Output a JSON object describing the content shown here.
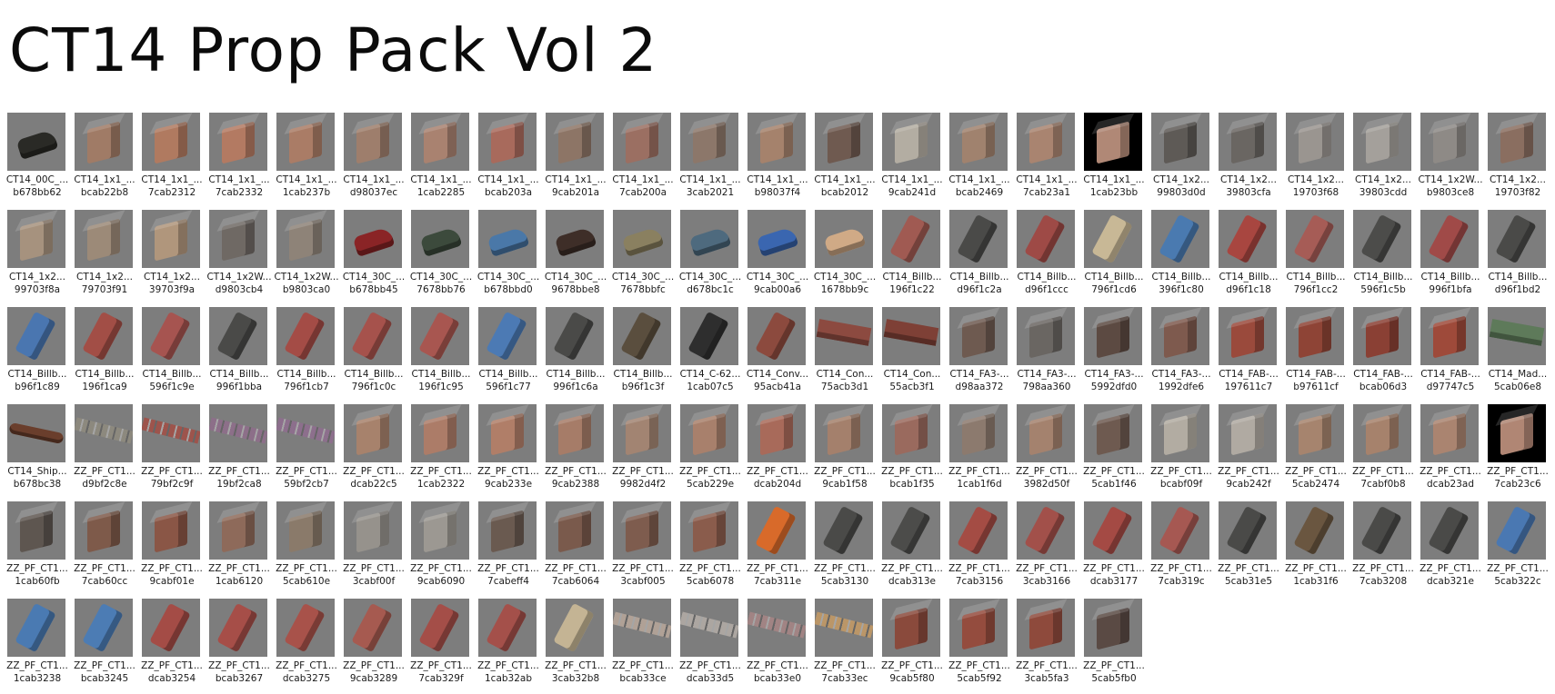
{
  "page_title": "CT14 Prop Pack Vol 2",
  "colors": {
    "thumb_bg": "#7d7d7d",
    "text": "#1a1a1a"
  },
  "items": [
    {
      "name": "CT14_00C_...",
      "id": "b678bb62",
      "kind": "car",
      "color": "#2a2a26"
    },
    {
      "name": "CT14_1x1_...",
      "id": "bcab22b8",
      "kind": "bldg",
      "color": "#a07b66"
    },
    {
      "name": "CT14_1x1_...",
      "id": "7cab2312",
      "kind": "bldg",
      "color": "#b07a60"
    },
    {
      "name": "CT14_1x1_...",
      "id": "7cab2332",
      "kind": "bldg",
      "color": "#b37a62"
    },
    {
      "name": "CT14_1x1_...",
      "id": "1cab237b",
      "kind": "bldg",
      "color": "#aa7c66"
    },
    {
      "name": "CT14_1x1_...",
      "id": "d98037ec",
      "kind": "bldg",
      "color": "#9e7e6c"
    },
    {
      "name": "CT14_1x1_...",
      "id": "1cab2285",
      "kind": "bldg",
      "color": "#a98270"
    },
    {
      "name": "CT14_1x1_...",
      "id": "bcab203a",
      "kind": "bldg",
      "color": "#a86a5c"
    },
    {
      "name": "CT14_1x1_...",
      "id": "9cab201a",
      "kind": "bldg",
      "color": "#8d7566"
    },
    {
      "name": "CT14_1x1_...",
      "id": "7cab200a",
      "kind": "bldg",
      "color": "#9b6f62"
    },
    {
      "name": "CT14_1x1_...",
      "id": "3cab2021",
      "kind": "bldg",
      "color": "#8c776a"
    },
    {
      "name": "CT14_1x1_...",
      "id": "b98037f4",
      "kind": "bldg",
      "color": "#a5826c"
    },
    {
      "name": "CT14_1x1_...",
      "id": "bcab2012",
      "kind": "bldg",
      "color": "#6f5a50"
    },
    {
      "name": "CT14_1x1_...",
      "id": "9cab241d",
      "kind": "bldg",
      "color": "#b3ada2"
    },
    {
      "name": "CT14_1x1_...",
      "id": "bcab2469",
      "kind": "bldg",
      "color": "#a0826e"
    },
    {
      "name": "CT14_1x1_...",
      "id": "7cab23a1",
      "kind": "bldg",
      "color": "#a98470"
    },
    {
      "name": "CT14_1x1_...",
      "id": "1cab23bb",
      "kind": "bldg",
      "color": "#b08876",
      "bg": "black"
    },
    {
      "name": "CT14_1x2...",
      "id": "99803d0d",
      "kind": "bldg",
      "color": "#5e5a56"
    },
    {
      "name": "CT14_1x2...",
      "id": "39803cfa",
      "kind": "bldg",
      "color": "#6a6662"
    },
    {
      "name": "CT14_1x2...",
      "id": "19703f68",
      "kind": "bldg",
      "color": "#9a9590"
    },
    {
      "name": "CT14_1x2...",
      "id": "39803cdd",
      "kind": "bldg",
      "color": "#a4a09b"
    },
    {
      "name": "CT14_1x2W...",
      "id": "b9803ce8",
      "kind": "bldg",
      "color": "#8e8a86"
    },
    {
      "name": "CT14_1x2...",
      "id": "19703f82",
      "kind": "bldg",
      "color": "#8a6e60"
    },
    {
      "name": "CT14_1x2...",
      "id": "99703f8a",
      "kind": "bldg",
      "color": "#a6927e"
    },
    {
      "name": "CT14_1x2...",
      "id": "79703f91",
      "kind": "bldg",
      "color": "#9c8a78"
    },
    {
      "name": "CT14_1x2...",
      "id": "39703f9a",
      "kind": "bldg",
      "color": "#b0967c"
    },
    {
      "name": "CT14_1x2W...",
      "id": "d9803cb4",
      "kind": "bldg",
      "color": "#6f6964"
    },
    {
      "name": "CT14_1x2W...",
      "id": "b9803ca0",
      "kind": "bldg",
      "color": "#8e8378"
    },
    {
      "name": "CT14_30C_...",
      "id": "b678bb45",
      "kind": "car",
      "color": "#8a2426"
    },
    {
      "name": "CT14_30C_...",
      "id": "7678bb76",
      "kind": "car",
      "color": "#3c4a3c"
    },
    {
      "name": "CT14_30C_...",
      "id": "b678bbd0",
      "kind": "car",
      "color": "#4a78a8"
    },
    {
      "name": "CT14_30C_...",
      "id": "9678bbe8",
      "kind": "car",
      "color": "#3e2e28"
    },
    {
      "name": "CT14_30C_...",
      "id": "7678bbfc",
      "kind": "car",
      "color": "#8a8060"
    },
    {
      "name": "CT14_30C_...",
      "id": "d678bc1c",
      "kind": "car",
      "color": "#4e6a7e"
    },
    {
      "name": "CT14_30C_...",
      "id": "9cab00a6",
      "kind": "car",
      "color": "#3a66b0"
    },
    {
      "name": "CT14_30C_...",
      "id": "1678bb9c",
      "kind": "car",
      "color": "#d0aa86"
    },
    {
      "name": "CT14_Billb...",
      "id": "196f1c22",
      "kind": "bill",
      "color": "#a05a52"
    },
    {
      "name": "CT14_Billb...",
      "id": "d96f1c2a",
      "kind": "bill",
      "color": "#4a4a48"
    },
    {
      "name": "CT14_Billb...",
      "id": "d96f1ccc",
      "kind": "bill",
      "color": "#9e4a46"
    },
    {
      "name": "CT14_Billb...",
      "id": "796f1cd6",
      "kind": "bill",
      "color": "#c8b896"
    },
    {
      "name": "CT14_Billb...",
      "id": "396f1c80",
      "kind": "bill",
      "color": "#4a7ab0"
    },
    {
      "name": "CT14_Billb...",
      "id": "d96f1c18",
      "kind": "bill",
      "color": "#a84640"
    },
    {
      "name": "CT14_Billb...",
      "id": "796f1cc2",
      "kind": "bill",
      "color": "#a65c56"
    },
    {
      "name": "CT14_Billb...",
      "id": "596f1c5b",
      "kind": "bill",
      "color": "#4c4c4a"
    },
    {
      "name": "CT14_Billb...",
      "id": "996f1bfa",
      "kind": "bill",
      "color": "#a04a48"
    },
    {
      "name": "CT14_Billb...",
      "id": "d96f1bd2",
      "kind": "bill",
      "color": "#4a4a48"
    },
    {
      "name": "CT14_Billb...",
      "id": "b96f1c89",
      "kind": "bill",
      "color": "#4a76b0"
    },
    {
      "name": "CT14_Billb...",
      "id": "196f1ca9",
      "kind": "bill",
      "color": "#a24e46"
    },
    {
      "name": "CT14_Billb...",
      "id": "596f1c9e",
      "kind": "bill",
      "color": "#a65450"
    },
    {
      "name": "CT14_Billb...",
      "id": "996f1bba",
      "kind": "bill",
      "color": "#4a4a48"
    },
    {
      "name": "CT14_Billb...",
      "id": "796f1cb7",
      "kind": "bill",
      "color": "#a44c46"
    },
    {
      "name": "CT14_Billb...",
      "id": "796f1c0c",
      "kind": "bill",
      "color": "#a6524c"
    },
    {
      "name": "CT14_Billb...",
      "id": "196f1c95",
      "kind": "bill",
      "color": "#a85650"
    },
    {
      "name": "CT14_Billb...",
      "id": "596f1c77",
      "kind": "bill",
      "color": "#4c7ab4"
    },
    {
      "name": "CT14_Billb...",
      "id": "996f1c6a",
      "kind": "bill",
      "color": "#4a4a48"
    },
    {
      "name": "CT14_Billb...",
      "id": "b96f1c3f",
      "kind": "bill",
      "color": "#5a4e3e"
    },
    {
      "name": "CT14_C-62...",
      "id": "1cab07c5",
      "kind": "bill",
      "color": "#2e2e2e"
    },
    {
      "name": "CT14_Conv...",
      "id": "95acb41a",
      "kind": "bill",
      "color": "#8c4a3e"
    },
    {
      "name": "CT14_Con...",
      "id": "75acb3d1",
      "kind": "flat",
      "color": "#8c4a40"
    },
    {
      "name": "CT14_Con...",
      "id": "55acb3f1",
      "kind": "flat",
      "color": "#7e4036"
    },
    {
      "name": "CT14_FA3-...",
      "id": "d98aa372",
      "kind": "bldg",
      "color": "#6e5a50"
    },
    {
      "name": "CT14_FA3-...",
      "id": "798aa360",
      "kind": "bldg",
      "color": "#6a6662"
    },
    {
      "name": "CT14_FA3-...",
      "id": "5992dfd0",
      "kind": "bldg",
      "color": "#5c4a42"
    },
    {
      "name": "CT14_FA3-...",
      "id": "1992dfe6",
      "kind": "bldg",
      "color": "#7e5a4e"
    },
    {
      "name": "CT14_FAB-...",
      "id": "197611c7",
      "kind": "bldg",
      "color": "#9a4a3c"
    },
    {
      "name": "CT14_FAB-...",
      "id": "b97611cf",
      "kind": "bldg",
      "color": "#8e4436"
    },
    {
      "name": "CT14_FAB-...",
      "id": "bcab06d3",
      "kind": "bldg",
      "color": "#8a4034"
    },
    {
      "name": "CT14_FAB-...",
      "id": "d97747c5",
      "kind": "bldg",
      "color": "#9e4a3a"
    },
    {
      "name": "CT14_Mad...",
      "id": "5cab06e8",
      "kind": "flat",
      "color": "#5e7a5a"
    },
    {
      "name": "CT14_Ship...",
      "id": "b678bc38",
      "kind": "ship",
      "color": "#6a3e2c"
    },
    {
      "name": "ZZ_PF_CT1...",
      "id": "d9bf2c8e",
      "kind": "strip",
      "color": "#8e8a7e"
    },
    {
      "name": "ZZ_PF_CT1...",
      "id": "79bf2c9f",
      "kind": "strip",
      "color": "#a05048"
    },
    {
      "name": "ZZ_PF_CT1...",
      "id": "19bf2ca8",
      "kind": "strip",
      "color": "#8e6e8a"
    },
    {
      "name": "ZZ_PF_CT1...",
      "id": "59bf2cb7",
      "kind": "strip",
      "color": "#8e6e8e"
    },
    {
      "name": "ZZ_PF_CT1...",
      "id": "dcab22c5",
      "kind": "bldg",
      "color": "#a7826c"
    },
    {
      "name": "ZZ_PF_CT1...",
      "id": "1cab2322",
      "kind": "bldg",
      "color": "#ac7c68"
    },
    {
      "name": "ZZ_PF_CT1...",
      "id": "9cab233e",
      "kind": "bldg",
      "color": "#b07e68"
    },
    {
      "name": "ZZ_PF_CT1...",
      "id": "9cab2388",
      "kind": "bldg",
      "color": "#a67c68"
    },
    {
      "name": "ZZ_PF_CT1...",
      "id": "9982d4f2",
      "kind": "bldg",
      "color": "#a28472"
    },
    {
      "name": "ZZ_PF_CT1...",
      "id": "5cab229e",
      "kind": "bldg",
      "color": "#a8806c"
    },
    {
      "name": "ZZ_PF_CT1...",
      "id": "dcab204d",
      "kind": "bldg",
      "color": "#a86a5a"
    },
    {
      "name": "ZZ_PF_CT1...",
      "id": "9cab1f58",
      "kind": "bldg",
      "color": "#a4806c"
    },
    {
      "name": "ZZ_PF_CT1...",
      "id": "bcab1f35",
      "kind": "bldg",
      "color": "#9a6a5e"
    },
    {
      "name": "ZZ_PF_CT1...",
      "id": "1cab1f6d",
      "kind": "bldg",
      "color": "#8c7a6e"
    },
    {
      "name": "ZZ_PF_CT1...",
      "id": "3982d50f",
      "kind": "bldg",
      "color": "#a4826e"
    },
    {
      "name": "ZZ_PF_CT1...",
      "id": "5cab1f46",
      "kind": "bldg",
      "color": "#6e5a50"
    },
    {
      "name": "ZZ_PF_CT1...",
      "id": "bcabf09f",
      "kind": "bldg",
      "color": "#b2aca2"
    },
    {
      "name": "ZZ_PF_CT1...",
      "id": "9cab242f",
      "kind": "bldg",
      "color": "#b0aaa2"
    },
    {
      "name": "ZZ_PF_CT1...",
      "id": "5cab2474",
      "kind": "bldg",
      "color": "#a6846e"
    },
    {
      "name": "ZZ_PF_CT1...",
      "id": "7cabf0b8",
      "kind": "bldg",
      "color": "#a6826c"
    },
    {
      "name": "ZZ_PF_CT1...",
      "id": "dcab23ad",
      "kind": "bldg",
      "color": "#aa8470"
    },
    {
      "name": "ZZ_PF_CT1...",
      "id": "7cab23c6",
      "kind": "bldg",
      "color": "#b08674",
      "bg": "black"
    },
    {
      "name": "ZZ_PF_CT1...",
      "id": "1cab60fb",
      "kind": "bldg",
      "color": "#5e5650"
    },
    {
      "name": "ZZ_PF_CT1...",
      "id": "7cab60cc",
      "kind": "bldg",
      "color": "#7e5a4a"
    },
    {
      "name": "ZZ_PF_CT1...",
      "id": "9cabf01e",
      "kind": "bldg",
      "color": "#8a5646"
    },
    {
      "name": "ZZ_PF_CT1...",
      "id": "1cab6120",
      "kind": "bldg",
      "color": "#8e6a5a"
    },
    {
      "name": "ZZ_PF_CT1...",
      "id": "5cab610e",
      "kind": "bldg",
      "color": "#8a7a6a"
    },
    {
      "name": "ZZ_PF_CT1...",
      "id": "3cabf00f",
      "kind": "bldg",
      "color": "#96928c"
    },
    {
      "name": "ZZ_PF_CT1...",
      "id": "9cab6090",
      "kind": "bldg",
      "color": "#9c9892"
    },
    {
      "name": "ZZ_PF_CT1...",
      "id": "7cabeff4",
      "kind": "bldg",
      "color": "#6a5a50"
    },
    {
      "name": "ZZ_PF_CT1...",
      "id": "7cab6064",
      "kind": "bldg",
      "color": "#7a5a4c"
    },
    {
      "name": "ZZ_PF_CT1...",
      "id": "3cabf005",
      "kind": "bldg",
      "color": "#7e5c4e"
    },
    {
      "name": "ZZ_PF_CT1...",
      "id": "5cab6078",
      "kind": "bldg",
      "color": "#8a5c4c"
    },
    {
      "name": "ZZ_PF_CT1...",
      "id": "7cab311e",
      "kind": "bill",
      "color": "#d86a2a"
    },
    {
      "name": "ZZ_PF_CT1...",
      "id": "5cab3130",
      "kind": "bill",
      "color": "#4a4a48"
    },
    {
      "name": "ZZ_PF_CT1...",
      "id": "dcab313e",
      "kind": "bill",
      "color": "#4c4c4a"
    },
    {
      "name": "ZZ_PF_CT1...",
      "id": "7cab3156",
      "kind": "bill",
      "color": "#a44c44"
    },
    {
      "name": "ZZ_PF_CT1...",
      "id": "3cab3166",
      "kind": "bill",
      "color": "#a2504a"
    },
    {
      "name": "ZZ_PF_CT1...",
      "id": "dcab3177",
      "kind": "bill",
      "color": "#a44a44"
    },
    {
      "name": "ZZ_PF_CT1...",
      "id": "7cab319c",
      "kind": "bill",
      "color": "#a65852"
    },
    {
      "name": "ZZ_PF_CT1...",
      "id": "5cab31e5",
      "kind": "bill",
      "color": "#4a4a48"
    },
    {
      "name": "ZZ_PF_CT1...",
      "id": "1cab31f6",
      "kind": "bill",
      "color": "#6a5640"
    },
    {
      "name": "ZZ_PF_CT1...",
      "id": "7cab3208",
      "kind": "bill",
      "color": "#4a4a48"
    },
    {
      "name": "ZZ_PF_CT1...",
      "id": "dcab321e",
      "kind": "bill",
      "color": "#4a4a48"
    },
    {
      "name": "ZZ_PF_CT1...",
      "id": "5cab322c",
      "kind": "bill",
      "color": "#4a78b2"
    },
    {
      "name": "ZZ_PF_CT1...",
      "id": "1cab3238",
      "kind": "bill",
      "color": "#4a7ab2"
    },
    {
      "name": "ZZ_PF_CT1...",
      "id": "bcab3245",
      "kind": "bill",
      "color": "#4c7cb4"
    },
    {
      "name": "ZZ_PF_CT1...",
      "id": "dcab3254",
      "kind": "bill",
      "color": "#a44c46"
    },
    {
      "name": "ZZ_PF_CT1...",
      "id": "bcab3267",
      "kind": "bill",
      "color": "#a64e48"
    },
    {
      "name": "ZZ_PF_CT1...",
      "id": "dcab3275",
      "kind": "bill",
      "color": "#a8524a"
    },
    {
      "name": "ZZ_PF_CT1...",
      "id": "9cab3289",
      "kind": "bill",
      "color": "#a65a50"
    },
    {
      "name": "ZZ_PF_CT1...",
      "id": "7cab329f",
      "kind": "bill",
      "color": "#a44e48"
    },
    {
      "name": "ZZ_PF_CT1...",
      "id": "1cab32ab",
      "kind": "bill",
      "color": "#a4504a"
    },
    {
      "name": "ZZ_PF_CT1...",
      "id": "3cab32b8",
      "kind": "bill",
      "color": "#c4b494"
    },
    {
      "name": "ZZ_PF_CT1...",
      "id": "bcab33ce",
      "kind": "strip",
      "color": "#b4a498"
    },
    {
      "name": "ZZ_PF_CT1...",
      "id": "dcab33d5",
      "kind": "strip",
      "color": "#b0aaa4"
    },
    {
      "name": "ZZ_PF_CT1...",
      "id": "bcab33e0",
      "kind": "strip",
      "color": "#a48484"
    },
    {
      "name": "ZZ_PF_CT1...",
      "id": "7cab33ec",
      "kind": "strip",
      "color": "#c09866"
    },
    {
      "name": "ZZ_PF_CT1...",
      "id": "9cab5f80",
      "kind": "bldg",
      "color": "#8a4a3c"
    },
    {
      "name": "ZZ_PF_CT1...",
      "id": "5cab5f92",
      "kind": "bldg",
      "color": "#944c3e"
    },
    {
      "name": "ZZ_PF_CT1...",
      "id": "3cab5fa3",
      "kind": "bldg",
      "color": "#8e4a3c"
    },
    {
      "name": "ZZ_PF_CT1...",
      "id": "5cab5fb0",
      "kind": "bldg",
      "color": "#5a4a44"
    }
  ]
}
